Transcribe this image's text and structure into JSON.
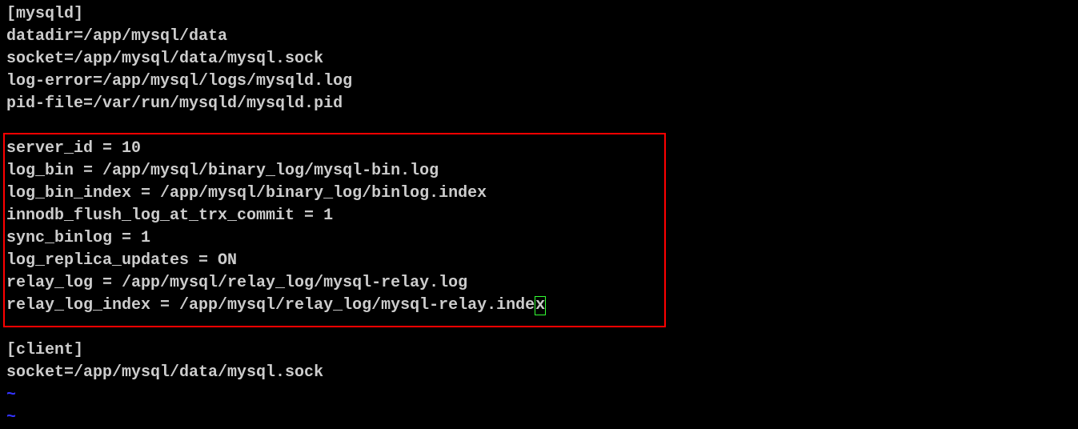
{
  "lines": {
    "l1": "[mysqld]",
    "l2": "datadir=/app/mysql/data",
    "l3": "socket=/app/mysql/data/mysql.sock",
    "l4": "log-error=/app/mysql/logs/mysqld.log",
    "l5": "pid-file=/var/run/mysqld/mysqld.pid",
    "l6": "",
    "l7": "server_id = 10",
    "l8": "log_bin = /app/mysql/binary_log/mysql-bin.log",
    "l9": "log_bin_index = /app/mysql/binary_log/binlog.index",
    "l10": "innodb_flush_log_at_trx_commit = 1",
    "l11": "sync_binlog = 1",
    "l12": "log_replica_updates = ON",
    "l13": "relay_log = /app/mysql/relay_log/mysql-relay.log",
    "l14_pre": "relay_log_index = /app/mysql/relay_log/mysql-relay.inde",
    "l14_cursor": "x",
    "l15": "",
    "l16": "[client]",
    "l17": "socket=/app/mysql/data/mysql.sock",
    "tilde1": "~",
    "tilde2": "~"
  }
}
